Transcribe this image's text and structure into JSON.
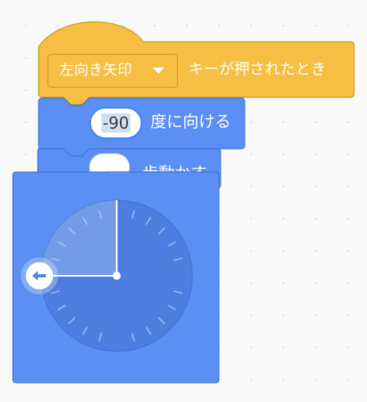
{
  "event_block": {
    "dropdown_label": "左向き矢印",
    "text": "キーが押されたとき"
  },
  "motion_block": {
    "direction_value": "-90",
    "text": "度に向ける"
  },
  "motion_block_2": {
    "text": "歩動かす"
  },
  "dial": {
    "direction": -90,
    "handle_icon": "left-arrow-icon"
  },
  "colors": {
    "event_yellow": "#f6bf43",
    "event_border": "#c89b2a",
    "motion_blue": "#5b8ff3",
    "motion_border": "#3e73d8",
    "dial_face": "#4e7fe0",
    "dial_light": "#7aa1e7"
  }
}
